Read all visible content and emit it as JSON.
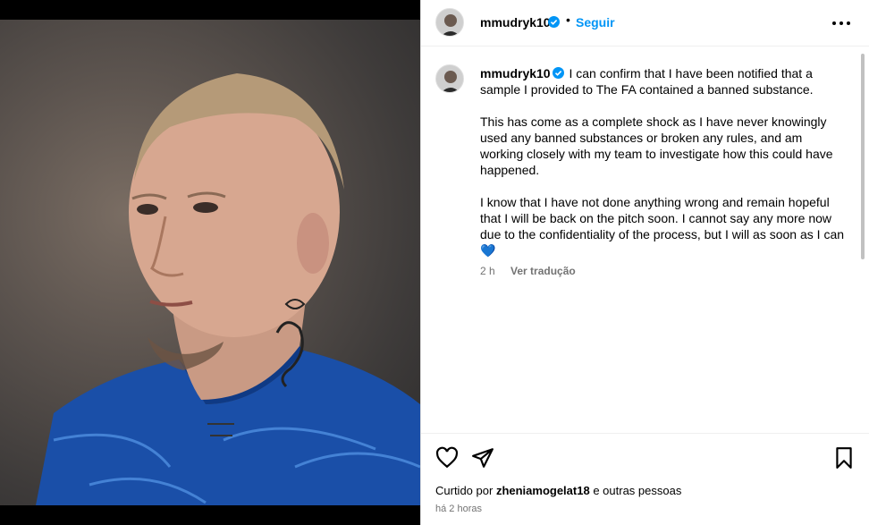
{
  "post": {
    "username": "mmudryk10",
    "follow_label": "Seguir",
    "separator": "•",
    "caption_paragraphs": [
      "I can confirm that I have been notified that a sample I provided to The FA contained a banned substance.",
      "This has come as a complete shock as I have never knowingly used any banned substances or broken any rules, and am working closely with my team to investigate how this could have happened.",
      "I know that I have not done anything wrong and remain hopeful that I will be back on the pitch soon. I cannot say any more now due to the confidentiality of the process, but I will as soon as I can💙"
    ],
    "comment_age": "2 h",
    "translate_label": "Ver tradução",
    "liked_by_prefix": "Curtido por",
    "liked_by_user": "zheniamogelat18",
    "liked_by_suffix": "e outras pessoas",
    "posted_time": "há 2 horas"
  },
  "icons": {
    "verified": "verified-badge-icon",
    "more": "more-options-icon",
    "like": "heart-icon",
    "share": "paper-plane-icon",
    "save": "bookmark-icon"
  },
  "colors": {
    "accent": "#0095f6",
    "secondary_text": "#737373",
    "verified": "#0095f6"
  }
}
